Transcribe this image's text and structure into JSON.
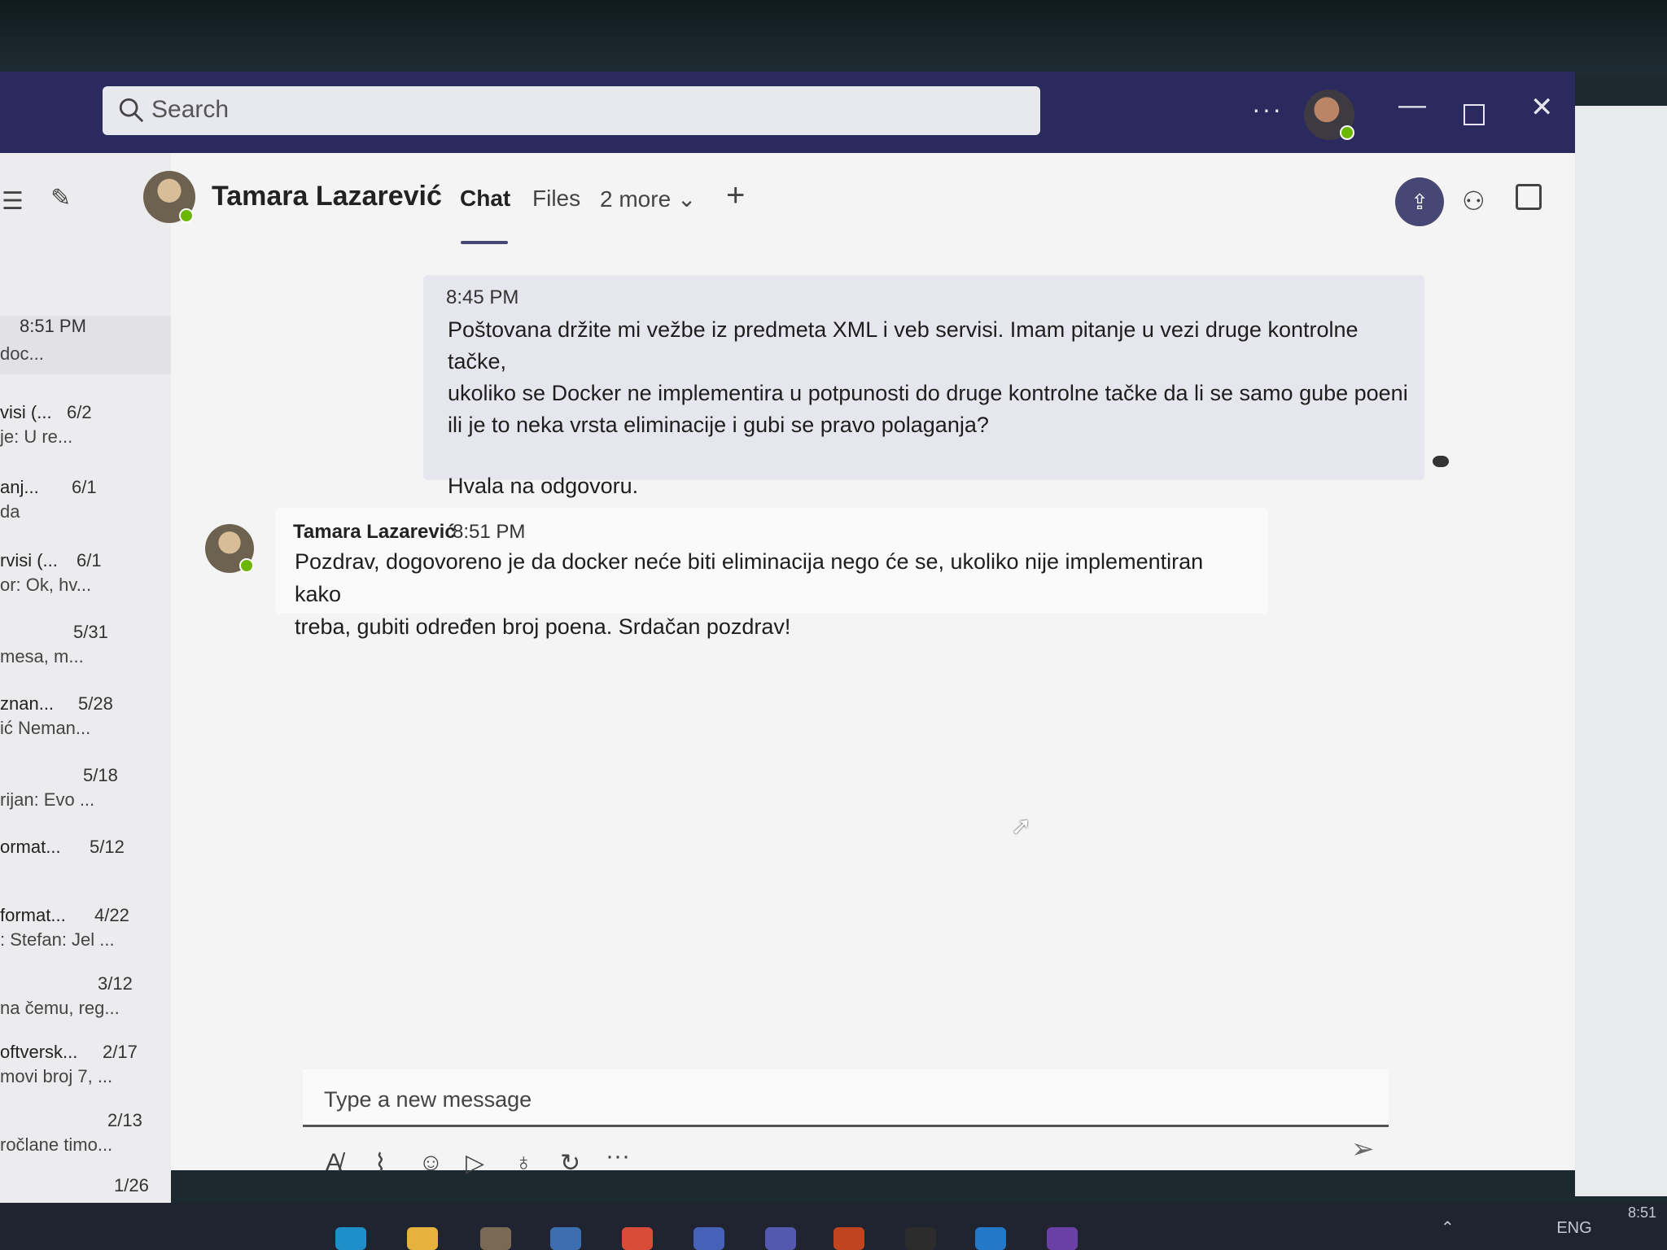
{
  "window": {
    "search_placeholder": "Search",
    "more_label": "···",
    "minimize_label": "—",
    "close_label": "✕"
  },
  "left_pane": {
    "items": [
      {
        "title": "",
        "date": "8:51 PM",
        "preview": "doc..."
      },
      {
        "title": "visi (...",
        "date": "6/2",
        "preview": "je: U re..."
      },
      {
        "title": "anj...",
        "date": "6/1",
        "preview": "da"
      },
      {
        "title": "rvisi (...",
        "date": "6/1",
        "preview": "or: Ok, hv..."
      },
      {
        "title": "",
        "date": "5/31",
        "preview": "mesa, m..."
      },
      {
        "title": "znan...",
        "date": "5/28",
        "preview": "ić Neman..."
      },
      {
        "title": "",
        "date": "5/18",
        "preview": "rijan: Evo ..."
      },
      {
        "title": "ormat...",
        "date": "5/12",
        "preview": ""
      },
      {
        "title": "format...",
        "date": "4/22",
        "preview": ": Stefan: Jel ..."
      },
      {
        "title": "",
        "date": "3/12",
        "preview": "na čemu, reg..."
      },
      {
        "title": "oftversk...",
        "date": "2/17",
        "preview": "movi broj 7, ..."
      },
      {
        "title": "",
        "date": "2/13",
        "preview": "ročlane timo..."
      },
      {
        "title": "",
        "date": "1/26",
        "preview": ""
      }
    ]
  },
  "header": {
    "contact_name": "Tamara Lazarević",
    "tabs": {
      "chat": "Chat",
      "files": "Files",
      "more": "2 more ⌄"
    },
    "add_tab": "+"
  },
  "messages": {
    "mine": {
      "time": "8:45 PM",
      "lines": [
        "Poštovana držite mi vežbe iz predmeta XML i veb servisi. Imam pitanje u vezi druge kontrolne tačke,",
        "ukoliko se Docker ne implementira u potpunosti do druge kontrolne tačke da li se samo gube poeni",
        "ili je to neka vrsta eliminacije i gubi se pravo polaganja?"
      ],
      "closing": "Hvala na odgovoru."
    },
    "reply": {
      "sender": "Tamara Lazarević",
      "time": "8:51 PM",
      "lines": [
        "Pozdrav, dogovoreno je da docker neće biti eliminacija nego će se, ukoliko nije implementiran kako",
        "treba, gubiti određen broj poena. Srdačan pozdrav!"
      ]
    }
  },
  "composer": {
    "placeholder": "Type a new message",
    "toolbar_icons": [
      "format-icon",
      "attach-icon",
      "emoji-icon",
      "sticker-icon",
      "praise-icon",
      "loop-icon",
      "more-options-icon",
      "send-icon"
    ]
  },
  "taskbar": {
    "tray_language": "ENG",
    "clock_time": "8:51"
  },
  "colors": {
    "titlebar": "#2b2a5e",
    "accent": "#464775",
    "presence": "#6bb700"
  }
}
